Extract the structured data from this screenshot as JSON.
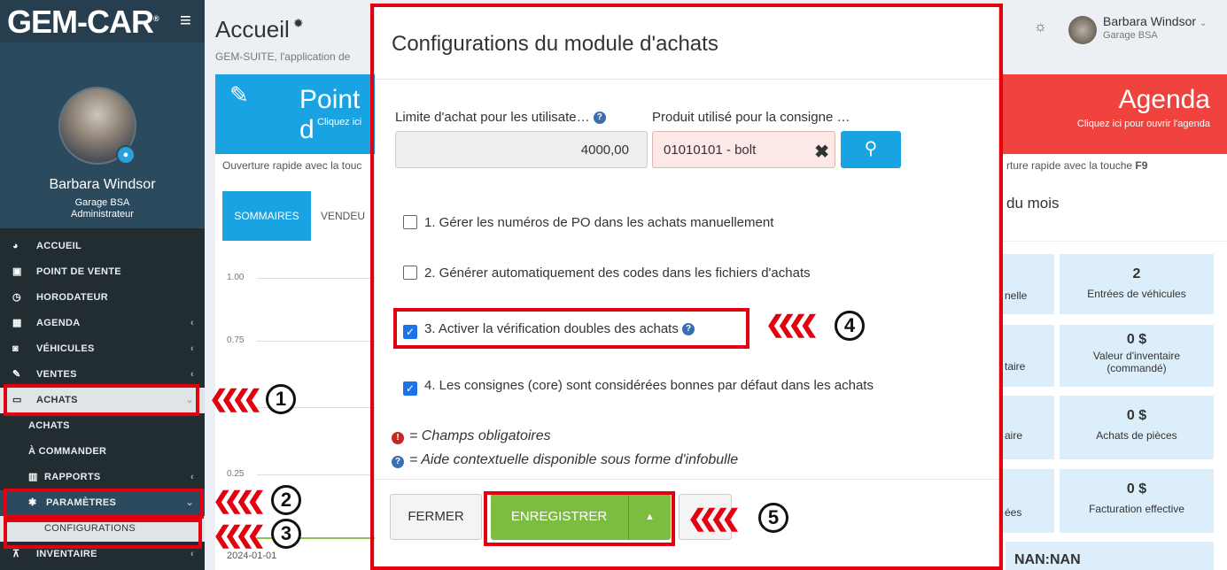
{
  "app": {
    "logo": "GEM-CAR",
    "logo_mark": "®"
  },
  "sidebar": {
    "user_name": "Barbara Windsor",
    "garage": "Garage BSA",
    "role": "Administrateur",
    "items": [
      {
        "label": "ACCUEIL",
        "icon": "dashboard-icon"
      },
      {
        "label": "POINT DE VENTE",
        "icon": "cash-icon"
      },
      {
        "label": "HORODATEUR",
        "icon": "clock-icon"
      },
      {
        "label": "AGENDA",
        "icon": "calendar-icon"
      },
      {
        "label": "VÉHICULES",
        "icon": "car-icon"
      },
      {
        "label": "VENTES",
        "icon": "edit-icon"
      },
      {
        "label": "ACHATS",
        "icon": "card-icon"
      },
      {
        "label": "ACHATS"
      },
      {
        "label": "À COMMANDER"
      },
      {
        "label": "RAPPORTS",
        "icon": "bar-chart-icon"
      },
      {
        "label": "PARAMÈTRES",
        "icon": "gear-icon"
      },
      {
        "label": "CONFIGURATIONS"
      },
      {
        "label": "INVENTAIRE",
        "icon": "cart-icon"
      }
    ]
  },
  "page": {
    "title": "Accueil",
    "subtitle": "GEM-SUITE, l'application de",
    "tile_left": {
      "title": "Point d",
      "sub": "Cliquez ici",
      "footer": "Ouverture rapide avec la touc"
    },
    "tile_right": {
      "title": "Agenda",
      "sub": "Cliquez ici pour ouvrir l'agenda",
      "footer": "rture rapide avec la touche ",
      "footer_key": "F9"
    },
    "tabs": [
      "SOMMAIRES",
      "VENDEU"
    ],
    "y_ticks": [
      "1.00",
      "0.75",
      "0.25"
    ],
    "x_tick": "2024-01-01",
    "month_title": "du mois",
    "stats": [
      {
        "value": "2",
        "label": "Entrées de véhicules",
        "left": "nelle"
      },
      {
        "value": "0 $",
        "label": "Valeur d'inventaire (commandé)",
        "left": "taire"
      },
      {
        "value": "0 $",
        "label": "Achats de pièces",
        "left": "aire"
      },
      {
        "value": "0 $",
        "label": "Facturation effective",
        "left": "ées"
      }
    ],
    "nan": "NAN:NAN"
  },
  "topbar": {
    "user": "Barbara Windsor",
    "garage": "Garage BSA"
  },
  "modal": {
    "title": "Configurations du module d'achats",
    "limit_label": "Limite d'achat pour les utilisate…",
    "limit_value": "4000,00",
    "product_label": "Produit utilisé pour la consigne …",
    "product_value": "01010101 - bolt",
    "checkboxes": [
      {
        "label": "1. Gérer les numéros de PO dans les achats manuellement",
        "checked": false
      },
      {
        "label": "2. Générer automatiquement des codes dans les fichiers d'achats",
        "checked": false
      },
      {
        "label": "3. Activer la vérification doubles des achats",
        "checked": true
      },
      {
        "label": "4. Les consignes (core) sont considérées bonnes par défaut dans les achats",
        "checked": true
      }
    ],
    "note_required": "= Champs obligatoires",
    "note_help": "= Aide contextuelle disponible sous forme d'infobulle",
    "btn_close": "FERMER",
    "btn_save": "ENREGISTRER"
  },
  "callouts": [
    "1",
    "2",
    "3",
    "4",
    "5"
  ],
  "colors": {
    "highlight": "#e3000f",
    "primary": "#1aa3e2",
    "success": "#7cbd41",
    "danger": "#f1433e",
    "sidebar": "#222d32"
  }
}
